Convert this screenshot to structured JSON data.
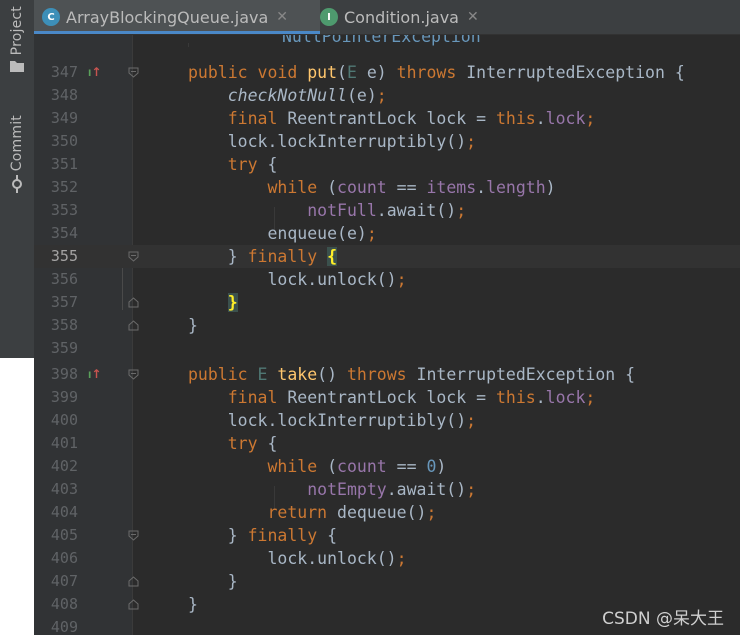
{
  "sidebar": {
    "project_label": "Project",
    "commit_label": "Commit"
  },
  "tabs": [
    {
      "label": "ArrayBlockingQueue.java",
      "icon_letter": "C",
      "icon_color": "#3d8fb8",
      "active": true
    },
    {
      "label": "Condition.java",
      "icon_letter": "I",
      "icon_color": "#4e9a6e",
      "active": false
    }
  ],
  "editor": {
    "partial_top_line": "NullPointerException",
    "line_numbers": [
      "347",
      "348",
      "349",
      "350",
      "351",
      "352",
      "353",
      "354",
      "355",
      "356",
      "357",
      "358",
      "359",
      "398",
      "399",
      "400",
      "401",
      "402",
      "403",
      "404",
      "405",
      "406",
      "407",
      "408",
      "409"
    ],
    "current_line": "355"
  },
  "colors": {
    "background": "#2b2b2b",
    "keyword": "#cc7832",
    "method": "#ffc66d",
    "field": "#9876aa",
    "number": "#6897bb",
    "text": "#a9b7c6"
  },
  "watermark": "CSDN @呆大王"
}
